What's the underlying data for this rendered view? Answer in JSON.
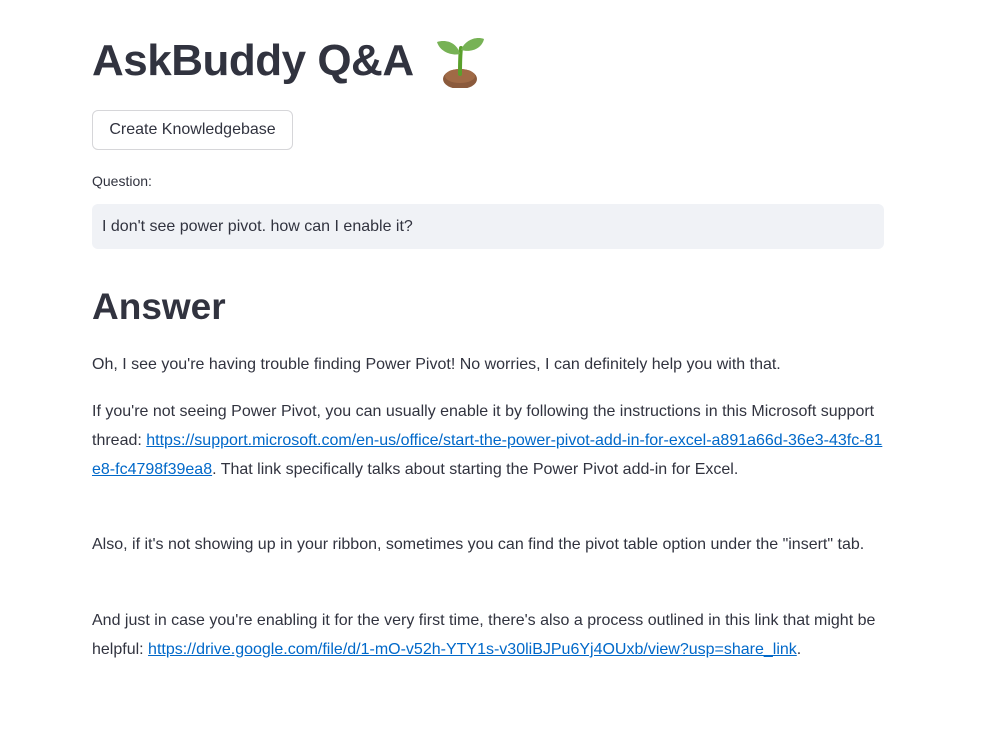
{
  "header": {
    "title": "AskBuddy Q&A",
    "icon": "seedling-icon"
  },
  "toolbar": {
    "create_kb_label": "Create Knowledgebase"
  },
  "question": {
    "label": "Question:",
    "value": "I don't see power pivot. how can I enable it?"
  },
  "answer": {
    "heading": "Answer",
    "p1": "Oh, I see you're having trouble finding Power Pivot! No worries, I can definitely help you with that.",
    "p2_before": "If you're not seeing Power Pivot, you can usually enable it by following the instructions in this Microsoft support thread: ",
    "p2_link": "https://support.microsoft.com/en-us/office/start-the-power-pivot-add-in-for-excel-a891a66d-36e3-43fc-81e8-fc4798f39ea8",
    "p2_after": ". That link specifically talks about starting the Power Pivot add-in for Excel.",
    "p3": "Also, if it's not showing up in your ribbon, sometimes you can find the pivot table option under the \"insert\" tab.",
    "p4_before": "And just in case you're enabling it for the very first time, there's also a process outlined in this link that might be helpful: ",
    "p4_link": "https://drive.google.com/file/d/1-mO-v52h-YTY1s-v30liBJPu6Yj4OUxb/view?usp=share_link",
    "p4_after": "."
  },
  "colors": {
    "text": "#31333f",
    "link": "#0068c9",
    "input_bg": "#f0f2f6"
  }
}
